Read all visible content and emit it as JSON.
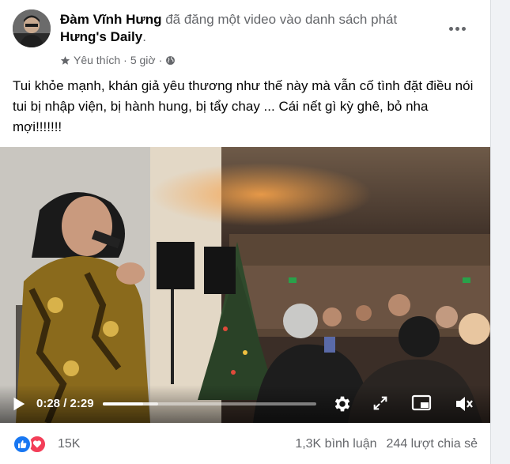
{
  "post": {
    "author": "Đàm Vĩnh Hưng",
    "action": " đã đăng một video vào danh sách phát ",
    "playlist": "Hưng's Daily",
    "playlist_suffix": ".",
    "meta_label": "Yêu thích",
    "meta_sep": "·",
    "meta_time": "5 giờ",
    "meta_sep2": "·",
    "text": "Tui khỏe mạnh, khán giả yêu thương như thế này mà vẫn cố tình đặt điều nói tui bị nhập viện, bị hành hung, bị tẩy chay ... Cái nết gì kỳ ghê, bỏ nha mợi!!!!!!!"
  },
  "video": {
    "current_time": "0:28",
    "time_sep": " / ",
    "duration": "2:29",
    "progress_fraction": 0.188,
    "buffered_fraction": 0.26
  },
  "footer": {
    "reaction_count": "15K",
    "comments": "1,3K bình luận",
    "shares": "244 lượt chia sẻ"
  },
  "icons": {
    "more": "more-options-icon",
    "favorite": "star-icon",
    "audience": "globe-icon",
    "play": "play-icon",
    "settings": "gear-icon",
    "fullscreen": "fullscreen-icon",
    "pip": "picture-in-picture-icon",
    "volume": "volume-muted-icon",
    "like": "like-icon",
    "love": "love-icon"
  },
  "colors": {
    "like_blue": "#1877f2",
    "love_red": "#f33e58",
    "secondary_text": "#65676b"
  }
}
